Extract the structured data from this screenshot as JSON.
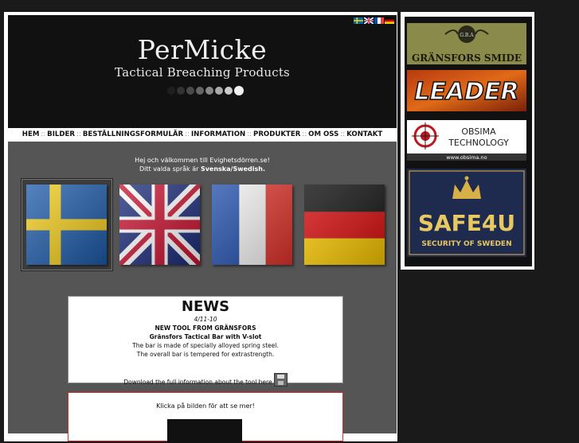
{
  "header": {
    "brand_name": "PerMicke",
    "brand_sub": "Tactical Breaching Products"
  },
  "nav": {
    "items": [
      "HEM",
      "BILDER",
      "BESTÄLLNINGSFORMULÄR",
      "INFORMATION",
      "PRODUKTER",
      "OM OSS",
      "KONTAKT"
    ]
  },
  "welcome": {
    "line1": "Hej och välkommen till Evighetsdörren.se!",
    "line2_prefix": "Ditt valda språk är ",
    "line2_lang": "Svenska/Swedish."
  },
  "news": {
    "title": "NEWS",
    "date": "4/11-10",
    "headline": "NEW TOOL FROM GRÄNSFORS",
    "subheadline": "Gränsfors Tactical Bar with V-slot",
    "line1": "The bar is made of specially alloyed spring steel.",
    "line2": "The overall bar is tempered for extrastrength.",
    "download": "Download the full information about the tool here"
  },
  "promo": {
    "text": "Klicka på bilden för att se mer!"
  },
  "sidebar": {
    "gransfors": {
      "badge": "G.B.A",
      "text": "GRÄNSFORS SMIDE"
    },
    "leader": {
      "text": "LEADER"
    },
    "obsima": {
      "line1": "OBSIMA",
      "line2": "TECHNOLOGY",
      "url": "www.obsima.no"
    },
    "safe4u": {
      "title": "SAFE4U",
      "sub": "SECURITY OF SWEDEN"
    }
  }
}
